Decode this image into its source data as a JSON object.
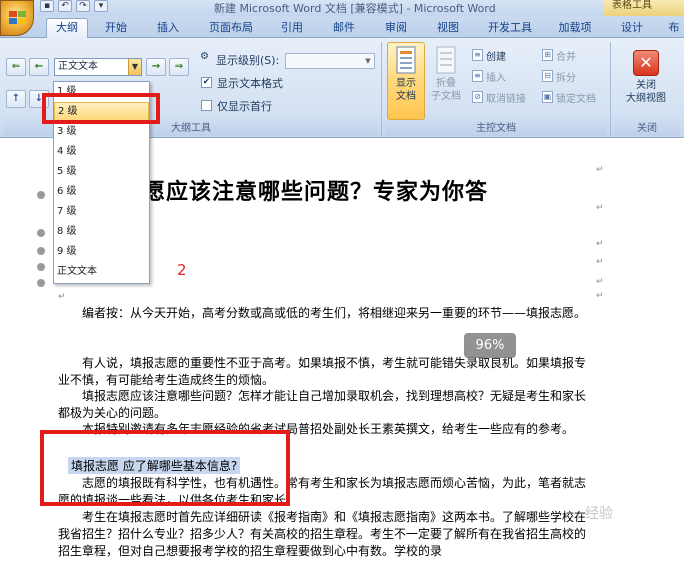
{
  "window": {
    "title": "新建 Microsoft Word 文档 [兼容模式] - Microsoft Word",
    "context_header": "表格工具"
  },
  "tabs": [
    "大纲",
    "开始",
    "插入",
    "页面布局",
    "引用",
    "邮件",
    "审阅",
    "视图",
    "开发工具",
    "加载项",
    "设计",
    "布"
  ],
  "outline_tools": {
    "level_value": "正文文本",
    "show_level_label": "显示级别(S):",
    "show_text_format_label": "显示文本格式",
    "show_text_format_checked": true,
    "first_line_only_label": "仅显示首行",
    "first_line_only_checked": false,
    "group_label": "大纲工具"
  },
  "master_doc": {
    "show_doc_label": "显示\n文档",
    "collapse_sub_label": "折叠\n子文档",
    "create_label": "创建",
    "insert_label": "插入",
    "unlink_label": "取消链接",
    "merge_label": "合并",
    "split_label": "拆分",
    "lock_label": "锁定文档",
    "group_label": "主控文档"
  },
  "close_group": {
    "close_label": "关闭\n大纲视图",
    "group_label": "关闭"
  },
  "level_dropdown": {
    "items": [
      "1 级",
      "2 级",
      "3 级",
      "4 级",
      "5 级",
      "6 级",
      "7 级",
      "8 级",
      "9 级",
      "正文文本"
    ],
    "highlighted_index": 1
  },
  "document": {
    "title": "志愿应该注意哪些问题？专家为你答",
    "annotation_label": "2",
    "zoom": "96%",
    "paragraphs": [
      "编者按：从今天开始，高考分数或高或低的考生们，将相继迎来另一重要的环节——填报志愿。",
      "有人说，填报志愿的重要性不亚于高考。如果填报不慎，考生就可能错失录取良机。如果填报专业不慎，有可能给考生造成终生的烦恼。",
      "填报志愿应该注意哪些问题？怎样才能让自己增加录取机会，找到理想高校？无疑是考生和家长都极为关心的问题。",
      "本报特别邀请有多年志愿经验的省考试局普招处副处长王素英撰文，给考生一些应有的参考。"
    ],
    "heading": "填报志愿 应了解哪些基本信息?",
    "paragraphs2": [
      "志愿的填报既有科学性，也有机遇性。常有考生和家长为填报志愿而烦心苦恼，为此，笔者就志愿的填报谈一些看法，以供各位考生和家长。",
      "考生在填报志愿时首先应详细研读《报考指南》和《填报志愿指南》这两本书。了解哪些学校在我省招生？招什么专业？招多少人？有关高校的招生章程。考生不一定要了解所有在我省招生高校的招生章程，但对自己想要报考学校的招生章程要做到心中有数。学校的录"
    ],
    "watermark": "经验"
  }
}
